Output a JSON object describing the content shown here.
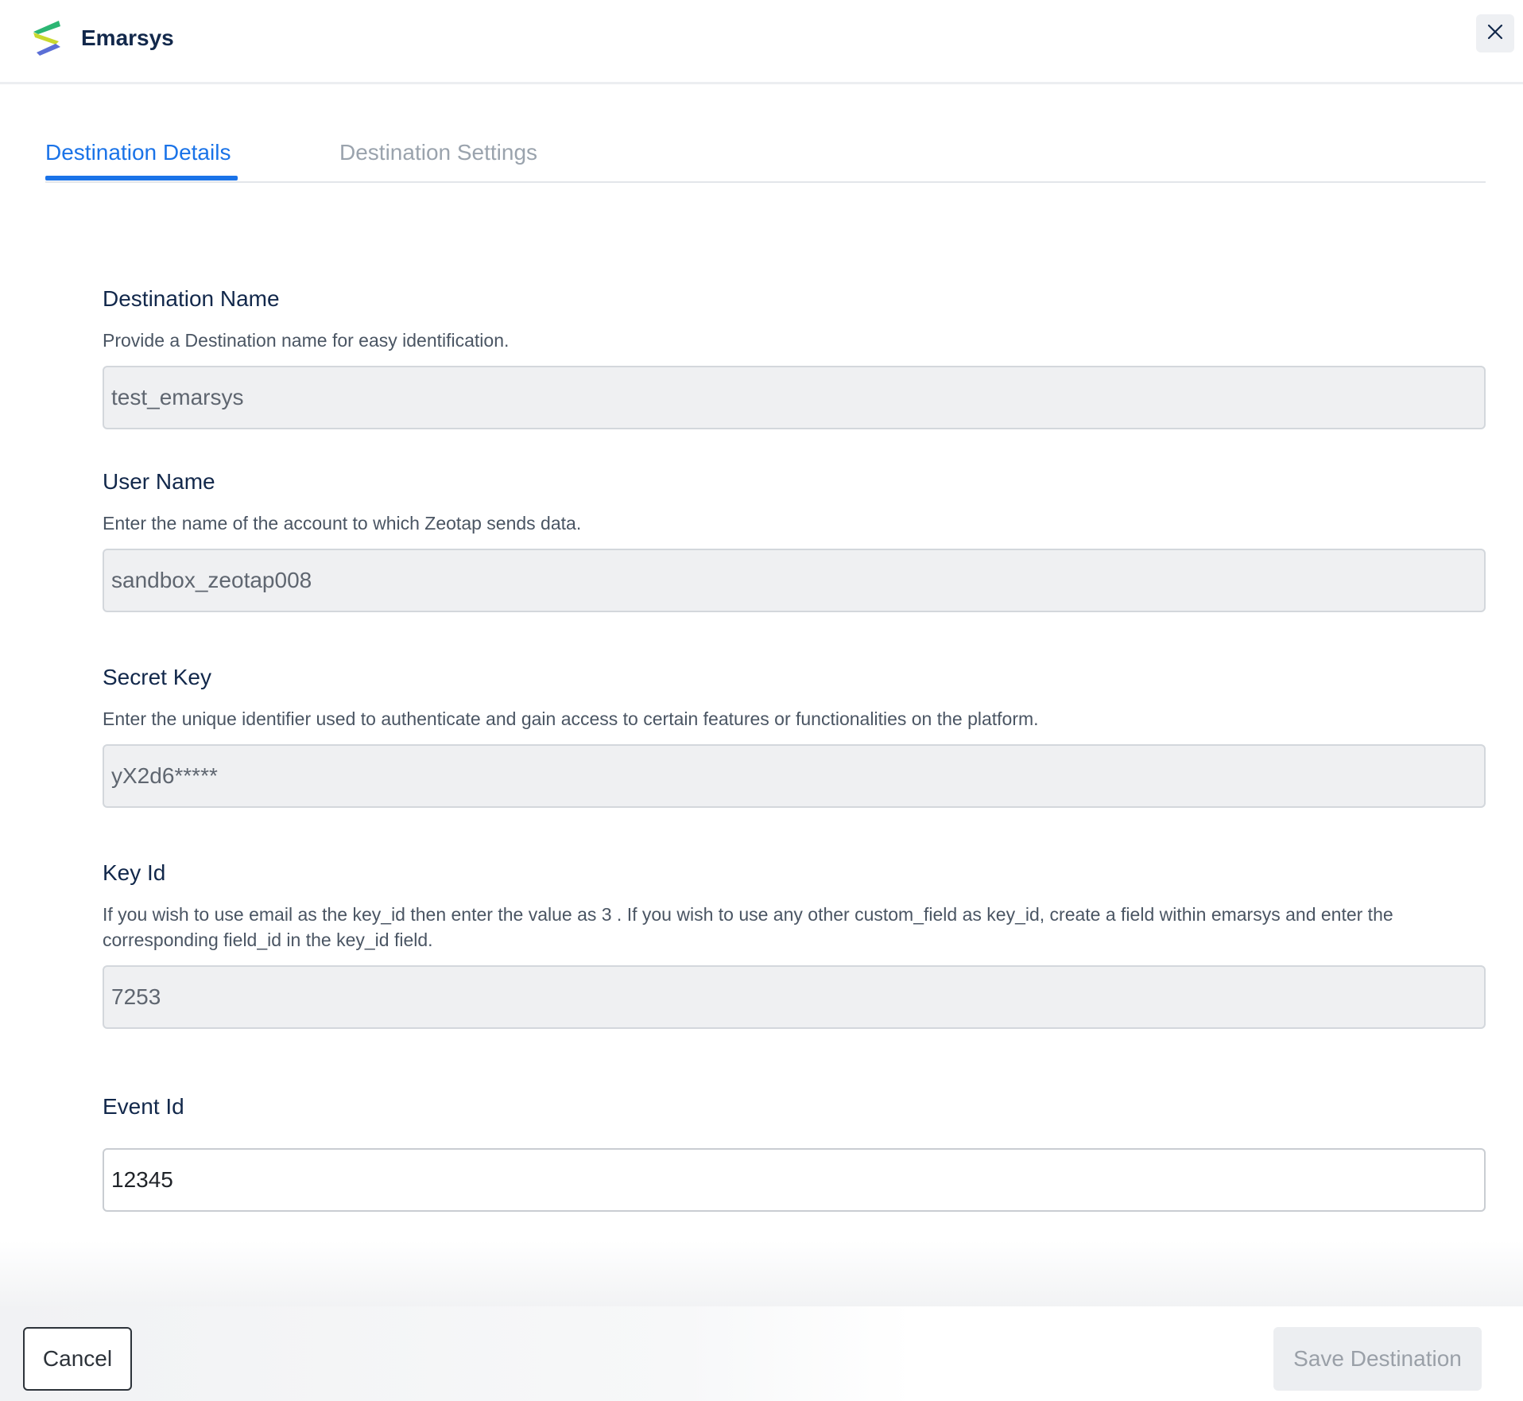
{
  "header": {
    "title": "Emarsys",
    "logo_icon": "emarsys-logo",
    "close_icon": "close-icon"
  },
  "tabs": [
    {
      "label": "Destination Details",
      "active": true
    },
    {
      "label": "Destination Settings",
      "active": false
    }
  ],
  "form": {
    "destination_name": {
      "label": "Destination Name",
      "description": "Provide a Destination name for easy identification.",
      "value": "test_emarsys",
      "disabled": true
    },
    "user_name": {
      "label": "User Name",
      "description": "Enter the name of the account to which Zeotap sends data.",
      "value": "sandbox_zeotap008",
      "disabled": true
    },
    "secret_key": {
      "label": "Secret Key",
      "description": "Enter the unique identifier used to authenticate and gain access to certain features or functionalities on the platform.",
      "value": "yX2d6*****",
      "disabled": true
    },
    "key_id": {
      "label": "Key Id",
      "description": "If you wish to use email as the key_id then enter the value as 3 . If you wish to use any other custom_field as key_id, create a field within emarsys and enter the corresponding field_id in the key_id field.",
      "value": "7253",
      "disabled": true
    },
    "event_id": {
      "label": "Event Id",
      "value": "12345",
      "disabled": false
    }
  },
  "footer": {
    "cancel_label": "Cancel",
    "save_label": "Save Destination",
    "save_disabled": true
  },
  "colors": {
    "accent": "#1a73e8",
    "heading": "#12284b",
    "logo_green": "#2bb673",
    "logo_yellow": "#c9d92e",
    "logo_blue": "#5b6fd6"
  }
}
